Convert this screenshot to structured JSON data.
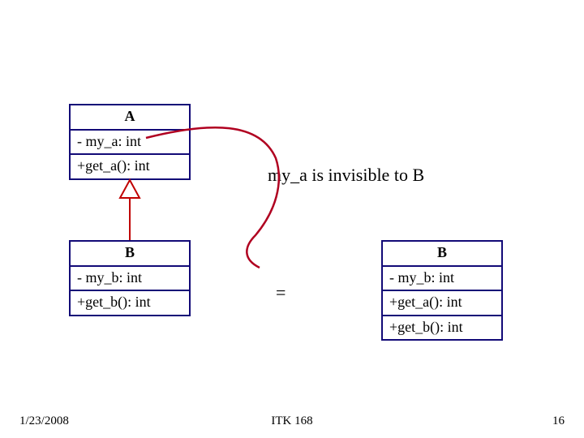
{
  "classA": {
    "name": "A",
    "attr": "- my_a: int",
    "op": "+get_a(): int"
  },
  "classB_left": {
    "name": "B",
    "attr": "- my_b: int",
    "op": "+get_b(): int"
  },
  "classB_right": {
    "name": "B",
    "attr": "- my_b: int",
    "op1": "+get_a(): int",
    "op2": "+get_b(): int"
  },
  "note_text": "my_a is invisible to B",
  "equals": "=",
  "footer": {
    "date": "1/23/2008",
    "course": "ITK 168",
    "slide": "16"
  },
  "colors": {
    "box_border": "#120a77",
    "arrow": "#c00000",
    "curve": "#b00020"
  }
}
